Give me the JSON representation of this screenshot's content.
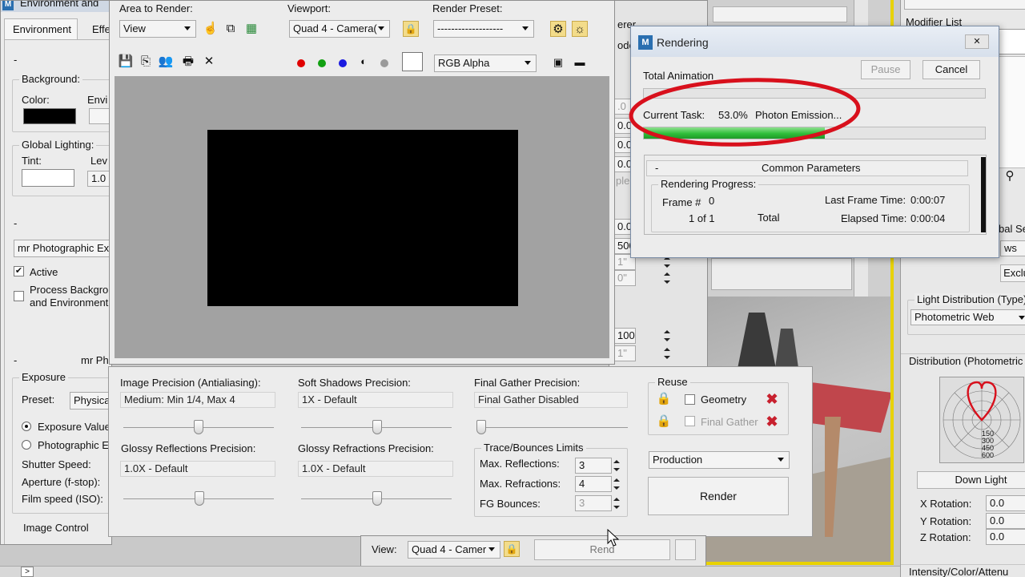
{
  "env": {
    "title": "Environment and",
    "tab_environment": "Environment",
    "tab_effects": "Effe",
    "minus": "-",
    "background_label": "Background:",
    "color_label": "Color:",
    "env_label": "Envi",
    "global_lighting_label": "Global Lighting:",
    "tint_label": "Tint:",
    "level_label": "Lev",
    "level_value": "1.0",
    "exposure_control": "mr Photographic Exp",
    "active_label": "Active",
    "process_bg_label": "Process Backgrou",
    "process_bg_label2": "and Environment",
    "section_mr": "mr Ph",
    "exposure_group": "Exposure",
    "preset_label": "Preset:",
    "preset_value": "Physica",
    "exposure_value_label": "Exposure Value",
    "photographic_label": "Photographic E",
    "shutter_label": "Shutter Speed:",
    "aperture_label": "Aperture (f-stop):",
    "film_label": "Film speed (ISO):",
    "image_control": "Image Control"
  },
  "frame": {
    "area_label": "Area to Render:",
    "area_value": "View",
    "viewport_label": "Viewport:",
    "viewport_value": "Quad 4 - Camera(",
    "preset_label": "Render Preset:",
    "preset_value": "-------------------",
    "channel_value": "RGB Alpha"
  },
  "settings": {
    "image_precision_label": "Image Precision (Antialiasing):",
    "image_precision_value": "Medium: Min 1/4, Max 4",
    "soft_shadows_label": "Soft Shadows Precision:",
    "soft_shadows_value": "1X - Default",
    "final_gather_label": "Final Gather Precision:",
    "final_gather_value": "Final Gather Disabled",
    "glossy_reflections_label": "Glossy Reflections Precision:",
    "glossy_reflections_value": "1.0X - Default",
    "glossy_refractions_label": "Glossy Refractions Precision:",
    "glossy_refractions_value": "1.0X - Default",
    "trace_group": "Trace/Bounces Limits",
    "max_reflections_label": "Max. Reflections:",
    "max_reflections_value": "3",
    "max_refractions_label": "Max. Refractions:",
    "max_refractions_value": "4",
    "fg_bounces_label": "FG Bounces:",
    "fg_bounces_value": "3",
    "reuse_group": "Reuse",
    "geometry_label": "Geometry",
    "final_gather_reuse_label": "Final Gather",
    "mode_value": "Production",
    "render_button": "Render",
    "view_label": "View:",
    "view_value": "Quad 4 - Camer",
    "render_behind": "Rend"
  },
  "rendering": {
    "title": "Rendering",
    "logo": "M",
    "close": "✕",
    "total_animation_label": "Total Animation",
    "pause_button": "Pause",
    "cancel_button": "Cancel",
    "current_task_label": "Current Task:",
    "current_task_percent": "53.0%",
    "current_task_name": "Photon Emission...",
    "progress_fraction": 0.53,
    "minus": "-",
    "common_parameters": "Common Parameters",
    "rendering_progress_label": "Rendering Progress:",
    "frame_label": "Frame #",
    "frame_value": "0",
    "frame_count": "1 of 1",
    "total_label": "Total",
    "last_frame_time_label": "Last Frame Time:",
    "last_frame_time_value": "0:00:07",
    "elapsed_time_label": "Elapsed Time:",
    "elapsed_time_value": "0:00:04",
    "highlight_color": "#d8101c"
  },
  "right_panel": {
    "modifier_list": "Modifier List",
    "light_distribution_group": "Light Distribution (Type)",
    "light_distribution_value": "Photometric Web",
    "exclude_button": "Exclu",
    "shadows_text": "ws",
    "global_settings_text": "bal Se",
    "distribution_section": "Distribution (Photometric",
    "web_labels": [
      "150",
      "300",
      "450",
      "600"
    ],
    "web_name": "Down Light",
    "x_rotation_label": "X Rotation:",
    "x_rotation_value": "0.0",
    "y_rotation_label": "Y Rotation:",
    "y_rotation_value": "0.0",
    "z_rotation_label": "Z Rotation:",
    "z_rotation_value": "0.0",
    "intensity_section": "Intensity/Color/Attenu"
  },
  "behind": {
    "erer": "erer",
    "ode": "ode",
    "v1": ".0",
    "v2": "0.0",
    "v3": "0.0",
    "v4": "0.0",
    "v5": "0.0",
    "v6": "500",
    "v7": "1\"",
    "v8": "0\"",
    "v9": "100",
    "v10": "1\"",
    "ple": "ple"
  },
  "status": {
    "arrow": ">"
  },
  "colors": {
    "progress_green": "#2fbf3a",
    "accent_yellow": "#e8d200"
  }
}
